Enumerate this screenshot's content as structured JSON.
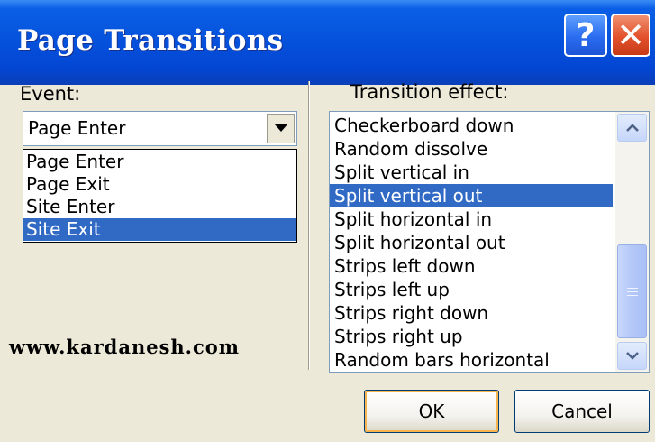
{
  "window": {
    "title": "Page Transitions",
    "help_glyph": "?",
    "close_glyph": "✕"
  },
  "event": {
    "label": "Event:",
    "selected_value": "Page Enter",
    "options": [
      "Page Enter",
      "Page Exit",
      "Site Enter",
      "Site Exit"
    ],
    "highlighted_option": "Site Exit"
  },
  "transition": {
    "label": "Transition effect:",
    "items": [
      "Checkerboard down",
      "Random dissolve",
      "Split vertical in",
      "Split vertical out",
      "Split horizontal in",
      "Split horizontal out",
      "Strips left down",
      "Strips left up",
      "Strips right down",
      "Strips right up",
      "Random bars horizontal"
    ],
    "selected_item": "Split vertical out"
  },
  "watermark": "www.kardanesh.com",
  "buttons": {
    "ok": "OK",
    "cancel": "Cancel"
  },
  "colors": {
    "titlebar": "#0653DC",
    "selection": "#316AC5",
    "dialog_bg": "#ECE9D8",
    "close_button": "#E2512C"
  },
  "icons": {
    "help": "help-icon",
    "close": "close-icon",
    "dropdown": "chevron-down-icon",
    "scroll_up": "scroll-up-icon",
    "scroll_down": "scroll-down-icon"
  }
}
